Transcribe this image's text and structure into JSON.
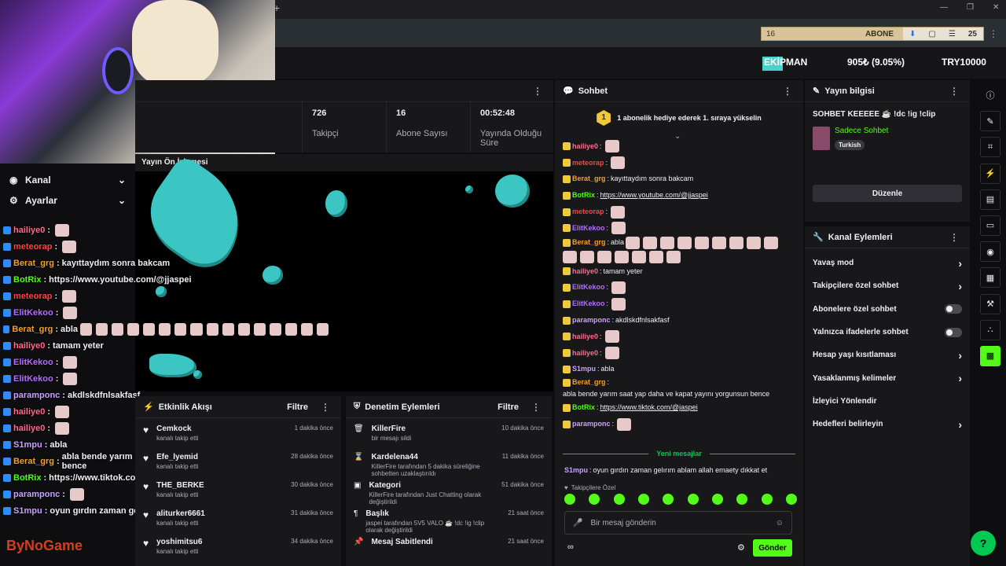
{
  "colors": {
    "accent": "#53fc18",
    "bg": "#0e0e10",
    "panel": "#18181b"
  },
  "overlay": {
    "ticker": {
      "count": "16",
      "label": "ABONE",
      "badge": "25"
    },
    "leaderboard": {
      "label": "EKİPMAN",
      "percent": "905₺ (9.05%)",
      "goal": "TRY10000"
    },
    "preview_title": "Yayın Ön İzlemesi",
    "watermark": "ByNoGame"
  },
  "left_menu": [
    {
      "label": "Kanal",
      "icon": "compass-icon"
    },
    {
      "label": "Ayarlar",
      "icon": "gear-icon"
    }
  ],
  "overlay_chat": [
    {
      "user": "hailiye0",
      "color": "#ff6b8a",
      "text": "",
      "emotes": 1
    },
    {
      "user": "meteorap",
      "color": "#ff4040",
      "text": "",
      "emotes": 1
    },
    {
      "user": "Berat_grg",
      "color": "#f0a030",
      "text": "kayıttaydım sonra bakcam",
      "emotes": 0
    },
    {
      "user": "BotRix",
      "color": "#53fc18",
      "text": "https://www.youtube.com/@jjaspei",
      "emotes": 0
    },
    {
      "user": "meteorap",
      "color": "#ff4040",
      "text": "",
      "emotes": 1
    },
    {
      "user": "ElitKekoo",
      "color": "#b56cff",
      "text": "",
      "emotes": 1
    },
    {
      "user": "Berat_grg",
      "color": "#f0a030",
      "text": "abla",
      "emotes": 16
    },
    {
      "user": "hailiye0",
      "color": "#ff6b8a",
      "text": "tamam yeter",
      "emotes": 0
    },
    {
      "user": "ElitKekoo",
      "color": "#b56cff",
      "text": "",
      "emotes": 1
    },
    {
      "user": "ElitKekoo",
      "color": "#b56cff",
      "text": "",
      "emotes": 1
    },
    {
      "user": "paramponc",
      "color": "#c9a0ff",
      "text": "akdlskdfnlsakfasf",
      "emotes": 0
    },
    {
      "user": "hailiye0",
      "color": "#ff6b8a",
      "text": "",
      "emotes": 1
    },
    {
      "user": "hailiye0",
      "color": "#ff6b8a",
      "text": "",
      "emotes": 1
    },
    {
      "user": "S1mpu",
      "color": "#c9a0ff",
      "text": "abla",
      "emotes": 0
    },
    {
      "user": "Berat_grg",
      "color": "#f0a030",
      "text": "abla bende yarım saat yap daha ve kapat yayını yorgunsun bence",
      "emotes": 0
    },
    {
      "user": "BotRix",
      "color": "#53fc18",
      "text": "https://www.tiktok.com/@jaspei",
      "emotes": 0
    },
    {
      "user": "paramponc",
      "color": "#c9a0ff",
      "text": "",
      "emotes": 1
    },
    {
      "user": "S1mpu",
      "color": "#c9a0ff",
      "text": "oyun gırdın zaman gelırım ablam allah emaety dıkkat et",
      "emotes": 0
    }
  ],
  "stats": [
    {
      "value": "726",
      "label": "Takipçi"
    },
    {
      "value": "16",
      "label": "Abone Sayısı"
    },
    {
      "value": "00:52:48",
      "label": "Yayında Olduğu Süre"
    }
  ],
  "activity": {
    "title": "Etkinlik Akışı",
    "filter": "Filtre",
    "items": [
      {
        "name": "Cemkock",
        "sub": "kanalı takip etti",
        "time": "1 dakika önce"
      },
      {
        "name": "Efe_lyemid",
        "sub": "kanalı takip etti",
        "time": "28 dakika önce"
      },
      {
        "name": "THE_BERKE",
        "sub": "kanalı takip etti",
        "time": "30 dakika önce"
      },
      {
        "name": "aliturker6661",
        "sub": "kanalı takip etti",
        "time": "31 dakika önce"
      },
      {
        "name": "yoshimitsu6",
        "sub": "kanalı takip etti",
        "time": "34 dakika önce"
      }
    ]
  },
  "moderation": {
    "title": "Denetim Eylemleri",
    "filter": "Filtre",
    "items": [
      {
        "name": "KillerFire",
        "sub": "bir mesajı sildi",
        "time": "10 dakika önce",
        "icon": "trash-icon"
      },
      {
        "name": "Kardelena44",
        "sub": "KillerFire tarafından 5 dakika süreliğine sohbetten uzaklaştırıldı",
        "time": "11 dakika önce",
        "icon": "hourglass-icon"
      },
      {
        "name": "Kategori",
        "sub": "KillerFire tarafından Just Chatting olarak değiştirildi",
        "time": "51 dakika önce",
        "icon": "category-icon"
      },
      {
        "name": "Başlık",
        "sub": "jaspei tarafından 5V5 VALO ☕ !dc !ig !clip olarak değiştirildi",
        "time": "21 saat önce",
        "icon": "text-icon"
      },
      {
        "name": "Mesaj Sabitlendi",
        "sub": "",
        "time": "21 saat önce",
        "icon": "pin-icon"
      }
    ]
  },
  "chat": {
    "title": "Sohbet",
    "pinned": "1 abonelik hediye ederek 1. sıraya yükselin",
    "messages": [
      {
        "user": "hailiye0",
        "color": "#ff6b8a",
        "text": "",
        "emotes": 1
      },
      {
        "user": "meteorap",
        "color": "#ff4040",
        "text": "",
        "emotes": 1
      },
      {
        "user": "Berat_grg",
        "color": "#f0a030",
        "text": "kayıttaydım sonra bakcam",
        "emotes": 0
      },
      {
        "user": "BotRix",
        "color": "#53fc18",
        "link": "https://www.youtube.com/@jjaspei",
        "text": "",
        "emotes": 0
      },
      {
        "user": "meteorap",
        "color": "#ff4040",
        "text": "",
        "emotes": 1
      },
      {
        "user": "ElitKekoo",
        "color": "#b56cff",
        "text": "",
        "emotes": 1
      },
      {
        "user": "Berat_grg",
        "color": "#f0a030",
        "text": "abla",
        "emotes": 16
      },
      {
        "user": "hailiye0",
        "color": "#ff6b8a",
        "text": "tamam yeter",
        "emotes": 0
      },
      {
        "user": "ElitKekoo",
        "color": "#b56cff",
        "text": "",
        "emotes": 1
      },
      {
        "user": "ElitKekoo",
        "color": "#b56cff",
        "text": "",
        "emotes": 1
      },
      {
        "user": "paramponc",
        "color": "#c9a0ff",
        "text": "akdlskdfnlsakfasf",
        "emotes": 0
      },
      {
        "user": "hailiye0",
        "color": "#ff6b8a",
        "text": "",
        "emotes": 1
      },
      {
        "user": "hailiye0",
        "color": "#ff6b8a",
        "text": "",
        "emotes": 1
      },
      {
        "user": "S1mpu",
        "color": "#c9a0ff",
        "text": "abla",
        "emotes": 0
      },
      {
        "user": "Berat_grg",
        "color": "#f0a030",
        "text": "abla bende yarım saat yap daha ve kapat yayını yorgunsun bence",
        "emotes": 0
      },
      {
        "user": "BotRix",
        "color": "#53fc18",
        "link": "https://www.tiktok.com/@jaspei",
        "text": "",
        "emotes": 0
      },
      {
        "user": "paramponc",
        "color": "#c9a0ff",
        "text": "",
        "emotes": 1
      }
    ],
    "new_messages": "Yeni mesajlar",
    "last": {
      "user": "S1mpu",
      "color": "#c9a0ff",
      "text": "oyun gırdın zaman gelırım ablam allah emaety dıkkat et"
    },
    "followers_only": "Takipçilere Özel",
    "placeholder": "Bir mesaj gönderin",
    "send": "Gönder"
  },
  "stream_info": {
    "title_label": "Yayın bilgisi",
    "title": "SOHBET KEEEEE ☕ !dc !ig !clip",
    "category": "Sadece Sohbet",
    "tag": "Turkish",
    "edit": "Düzenle"
  },
  "channel_actions": {
    "title": "Kanal Eylemleri",
    "items": [
      {
        "label": "Yavaş mod",
        "type": "chevron"
      },
      {
        "label": "Takipçilere özel sohbet",
        "type": "chevron"
      },
      {
        "label": "Abonelere özel sohbet",
        "type": "toggle"
      },
      {
        "label": "Yalnızca ifadelerle sohbet",
        "type": "toggle"
      },
      {
        "label": "Hesap yaşı kısıtlaması",
        "type": "chevron"
      },
      {
        "label": "Yasaklanmış kelimeler",
        "type": "chevron"
      },
      {
        "label": "İzleyici Yönlendir",
        "type": "none"
      },
      {
        "label": "Hedefleri belirleyin",
        "type": "chevron"
      }
    ]
  },
  "rail": [
    "info-icon",
    "pencil-icon",
    "focus-icon",
    "bolt-icon",
    "clipboard-icon",
    "chat-icon",
    "broadcast-icon",
    "layout-icon",
    "wrench-icon",
    "dots-icon",
    "clapper-icon"
  ]
}
